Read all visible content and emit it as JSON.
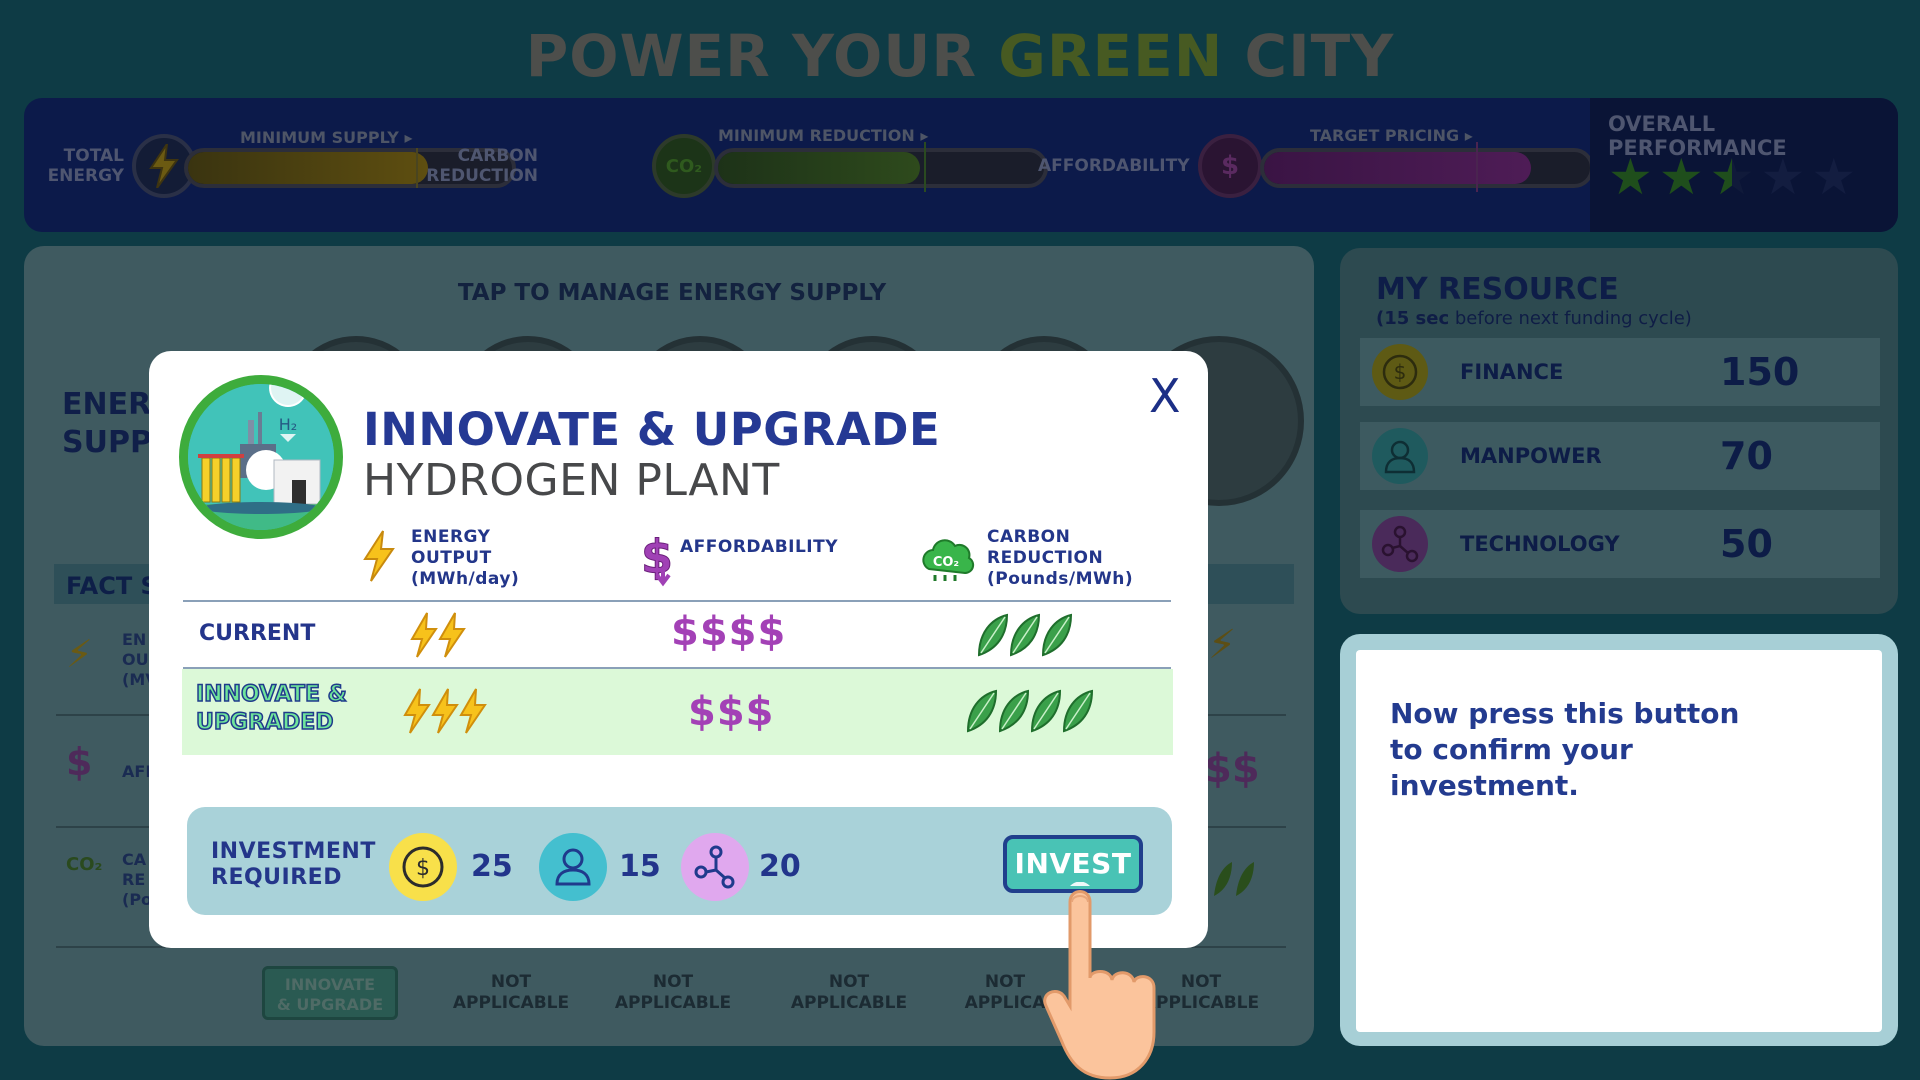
{
  "title": {
    "part1": "POWER YOUR",
    "part2": "GREEN",
    "part3": "CITY"
  },
  "hud": {
    "total_energy": "TOTAL ENERGY",
    "minimum_supply": "MINIMUM SUPPLY",
    "carbon_reduction": "CARBON REDUCTION",
    "minimum_reduction": "MINIMUM REDUCTION",
    "affordability": "AFFORDABILITY",
    "target_pricing": "TARGET PRICING",
    "overall_performance": "OVERALL PERFORMANCE",
    "stars_filled": 2.5,
    "stars_total": 5,
    "energy_level": 0.74,
    "carbon_level": 0.62,
    "afford_level": 0.82,
    "co2_icon": "CO₂",
    "dollar_icon": "$"
  },
  "main": {
    "tap_label": "TAP TO MANAGE ENERGY SUPPLY",
    "energy_supply_label": "ENERG\nSUPPL",
    "fact_title": "FACT S",
    "fact_rows": [
      {
        "icon": "bolt-icon",
        "text": "EN\nOU\n(MV"
      },
      {
        "icon": "dollar-icon",
        "text": "AFF"
      },
      {
        "icon": "co2-icon",
        "text": "CA\nRE\n(Po"
      }
    ],
    "bottom_button": "INNOVATE\n& UPGRADE",
    "not_applicable": [
      "NOT\nAPPLICABLE",
      "NOT\nAPPLICABLE",
      "NOT\nAPPLICABLE",
      "NOT\nAPPLICA",
      "NOT\nAPPLICABLE"
    ],
    "right_dollars": "$$"
  },
  "resources": {
    "title": "MY RESOURCE",
    "subtitle_bold": "(15 sec",
    "subtitle_rest": " before next funding cycle)",
    "items": [
      {
        "name": "FINANCE",
        "value": "150",
        "icon": "coin-icon"
      },
      {
        "name": "MANPOWER",
        "value": "70",
        "icon": "person-icon"
      },
      {
        "name": "TECHNOLOGY",
        "value": "50",
        "icon": "network-icon"
      }
    ]
  },
  "instruction": "Now press this button to confirm your investment.",
  "modal": {
    "close": "X",
    "title": "INNOVATE & UPGRADE",
    "subtitle": "HYDROGEN PLANT",
    "plant_h2": "H₂",
    "columns": [
      {
        "label": "ENERGY\nOUTPUT\n(MWh/day)",
        "icon": "bolt-icon"
      },
      {
        "label": "AFFORDABILITY",
        "icon": "dollar-icon"
      },
      {
        "label": "CARBON\nREDUCTION\n(Pounds/MWh)",
        "icon": "co2-icon"
      }
    ],
    "current": {
      "label": "CURRENT",
      "bolts": 2,
      "dollars": "$$$$",
      "leaves": 3
    },
    "upgraded": {
      "label": "INNOVATE &\nUPGRADED",
      "bolts": 3,
      "dollars": "$$$",
      "leaves": 4
    },
    "investment": {
      "label": "INVESTMENT\nREQUIRED",
      "finance": "25",
      "manpower": "15",
      "technology": "20",
      "button": "INVEST"
    }
  }
}
